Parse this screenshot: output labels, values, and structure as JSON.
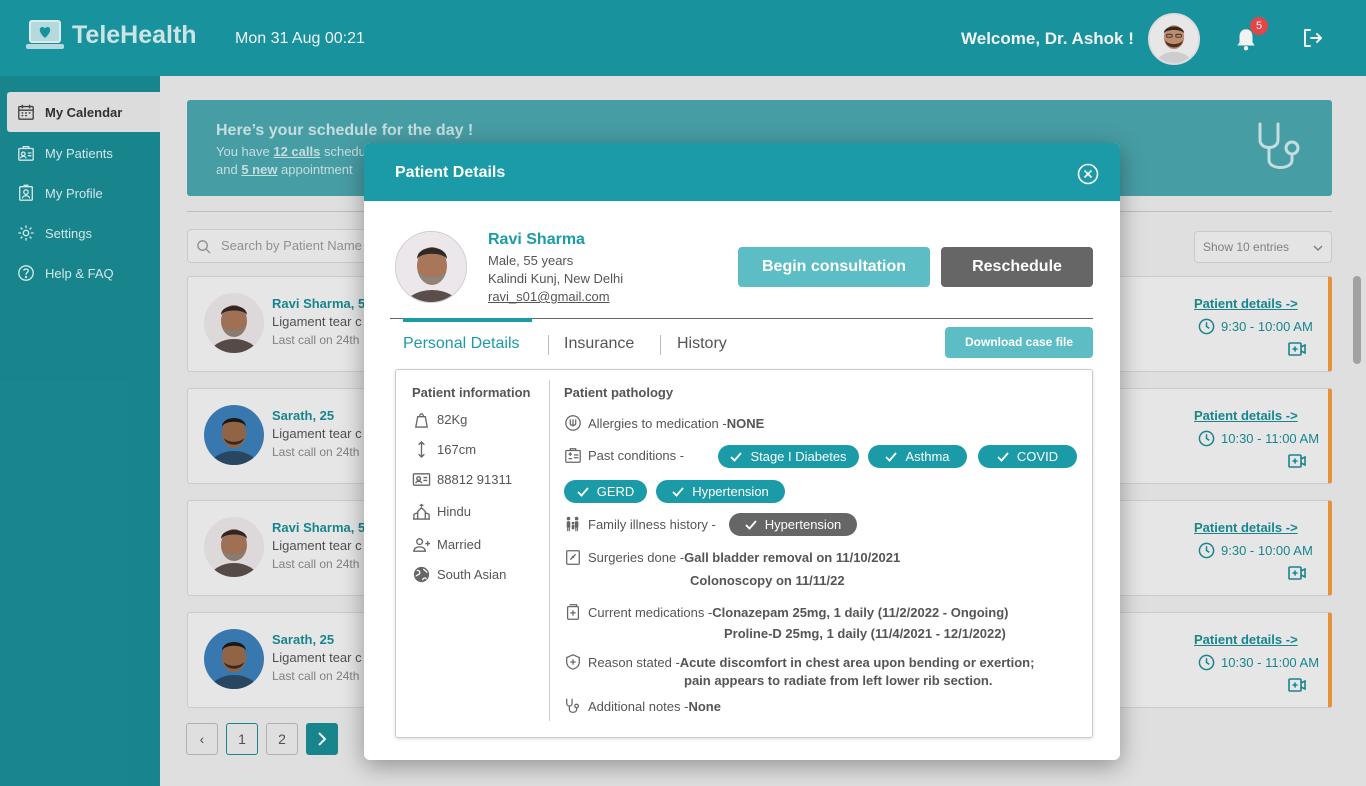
{
  "header": {
    "logo_text": "TeleHealth",
    "datetime": "Mon 31 Aug 00:21",
    "welcome": "Welcome, Dr. Ashok !",
    "notifications_count": "5"
  },
  "sidebar": {
    "items": [
      {
        "label": "My Calendar",
        "icon": "calendar-icon",
        "active": true
      },
      {
        "label": "My Patients",
        "icon": "patients-icon"
      },
      {
        "label": "My Profile",
        "icon": "profile-icon"
      },
      {
        "label": "Settings",
        "icon": "gear-icon"
      },
      {
        "label": "Help & FAQ",
        "icon": "help-icon"
      }
    ]
  },
  "banner": {
    "title": "Here’s your schedule for the day !",
    "line1_a": "You have ",
    "line1_calls": "12 calls",
    "line1_b": " schedu",
    "line2_a": "and ",
    "line2_new": "5 new",
    "line2_b": " appointment"
  },
  "search": {
    "placeholder": "Search by Patient Name"
  },
  "entries": {
    "label": "Show 10 entries"
  },
  "appointments": [
    {
      "name": "Ravi Sharma, 5",
      "condition": "Ligament tear c",
      "last_call": "Last call on 24th",
      "link": "Patient details ->",
      "time": "9:30 - 10:00 AM"
    },
    {
      "name": "Sarath, 25",
      "condition": "Ligament tear c",
      "last_call": "Last call on 24th",
      "link": "Patient details ->",
      "time": "10:30 - 11:00 AM"
    },
    {
      "name": "Ravi Sharma, 5",
      "condition": "Ligament tear c",
      "last_call": "Last call on 24th",
      "link": "Patient details ->",
      "time": "9:30 - 10:00 AM"
    },
    {
      "name": "Sarath, 25",
      "condition": "Ligament tear c",
      "last_call": "Last call on 24th",
      "link": "Patient details ->",
      "time": "10:30 - 11:00 AM"
    }
  ],
  "pagination": {
    "prev": "‹",
    "pages": [
      "1",
      "2"
    ],
    "next": "›"
  },
  "modal": {
    "title": "Patient Details",
    "patient": {
      "name": "Ravi Sharma",
      "gender_age": "Male, 55 years",
      "location": "Kalindi Kunj, New Delhi",
      "email": "ravi_s01@gmail.com"
    },
    "begin_label": "Begin consultation",
    "reschedule_label": "Reschedule",
    "tabs": [
      "Personal Details",
      "Insurance",
      "History"
    ],
    "download_label": "Download case file",
    "info_title": "Patient information",
    "info": [
      {
        "value": "82Kg",
        "icon": "weight-icon"
      },
      {
        "value": "167cm",
        "icon": "height-icon"
      },
      {
        "value": "88812 91311",
        "icon": "id-card-icon"
      },
      {
        "value": "Hindu",
        "icon": "religion-icon"
      },
      {
        "value": "Married",
        "icon": "marital-icon"
      },
      {
        "value": "South Asian",
        "icon": "globe-icon"
      }
    ],
    "pathology_title": "Patient pathology",
    "allergies_label": "Allergies to medication - ",
    "allergies_value": "NONE",
    "past_label": "Past conditions -",
    "past_conditions": [
      "Stage I Diabetes",
      "Asthma",
      "COVID",
      "GERD",
      "Hypertension"
    ],
    "family_label": "Family illness history -",
    "family_conditions": [
      "Hypertension"
    ],
    "surgeries_label": "Surgeries done - ",
    "surgeries": [
      "Gall bladder removal on 11/10/2021",
      "Colonoscopy on 11/11/22"
    ],
    "medications_label": "Current medications - ",
    "medications": [
      "Clonazepam 25mg, 1 daily (11/2/2022 - Ongoing)",
      "Proline-D 25mg, 1 daily (11/4/2021 - 12/1/2022)"
    ],
    "reason_label": "Reason stated - ",
    "reason": [
      "Acute discomfort in chest area upon bending or exertion;",
      "pain appears to radiate from left lower rib section."
    ],
    "notes_label": "Additional notes - ",
    "notes_value": "None"
  },
  "colors": {
    "primary": "#1a9ba7",
    "sidebar": "#1a8d95",
    "accent_orange": "#f09a3e",
    "badge_red": "#ef4a4a",
    "button_light": "#5dbdc5",
    "button_dark": "#666666"
  }
}
